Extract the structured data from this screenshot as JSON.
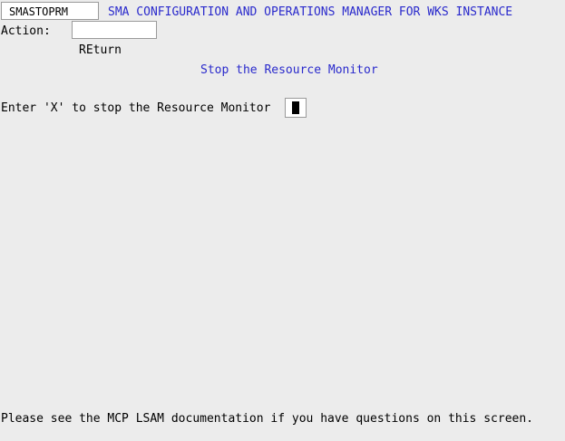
{
  "header": {
    "screen_id": "SMASTOPRM",
    "title": "SMA CONFIGURATION AND OPERATIONS MANAGER FOR WKS INSTANCE"
  },
  "action": {
    "label": "Action:",
    "value": "",
    "return_option": "REturn"
  },
  "screen": {
    "subtitle": "Stop the Resource Monitor",
    "prompt": "Enter 'X' to stop the Resource Monitor",
    "field_value": ""
  },
  "footer": {
    "help_text": "Please see the MCP LSAM documentation if you have questions on this screen."
  },
  "colors": {
    "background": "#ececec",
    "title_blue": "#2a2acc",
    "field_bg": "#ffffff",
    "field_border": "#9a9a9a"
  }
}
